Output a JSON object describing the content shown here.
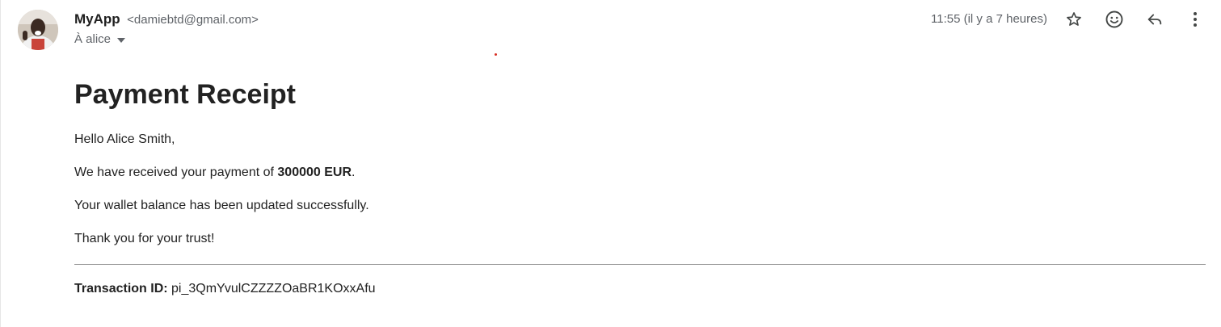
{
  "sender": {
    "name": "MyApp",
    "email": "<damiebtd@gmail.com>"
  },
  "recipient": {
    "label": "À alice"
  },
  "timestamp": "11:55 (il y a 7 heures)",
  "icons": {
    "star": "star-icon",
    "emoji": "emoji-reaction-icon",
    "reply": "reply-icon",
    "more": "more-vert-icon",
    "caret": "caret-down-icon"
  },
  "message": {
    "title": "Payment Receipt",
    "greeting": "Hello Alice Smith,",
    "payment_prefix": "We have received your payment of ",
    "payment_amount": "300000 EUR",
    "payment_suffix": ".",
    "balance_text": "Your wallet balance has been updated successfully.",
    "thanks": "Thank you for your trust!",
    "transaction_label": "Transaction ID:",
    "transaction_id": " pi_3QmYvulCZZZZOaBR1KOxxAfu"
  },
  "colors": {
    "secondary_text": "#5f6368",
    "accent_dot": "#d93025"
  }
}
